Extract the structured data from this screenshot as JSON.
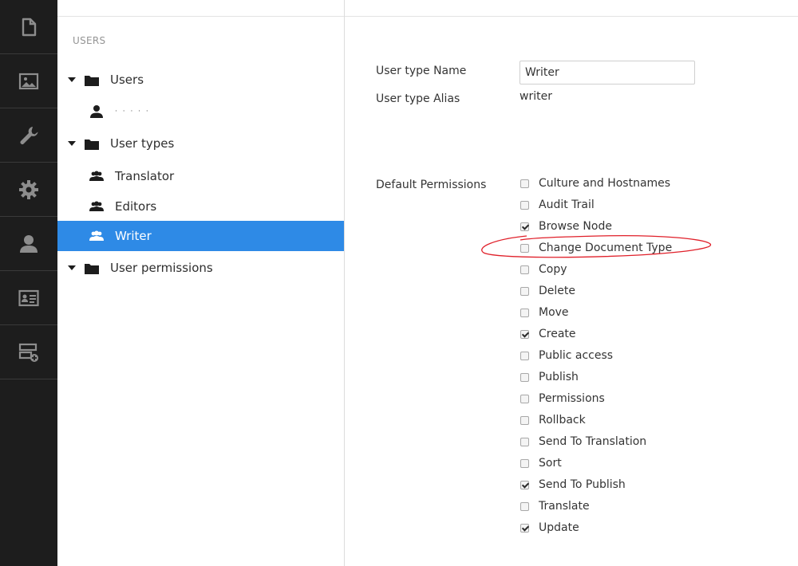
{
  "rail": {
    "items": [
      {
        "icon": "document-icon",
        "name": "rail-content"
      },
      {
        "icon": "image-icon",
        "name": "rail-media"
      },
      {
        "icon": "wrench-icon",
        "name": "rail-settings"
      },
      {
        "icon": "gear-icon",
        "name": "rail-developer"
      },
      {
        "icon": "user-icon",
        "name": "rail-users"
      },
      {
        "icon": "id-card-icon",
        "name": "rail-members"
      },
      {
        "icon": "forms-icon",
        "name": "rail-forms"
      }
    ]
  },
  "tree": {
    "heading": "USERS",
    "items": [
      {
        "label": "Users"
      },
      {
        "label": "· ·  ·   ·    ·"
      },
      {
        "label": "User types"
      },
      {
        "label": "Translator"
      },
      {
        "label": "Editors"
      },
      {
        "label": "Writer"
      },
      {
        "label": "User permissions"
      }
    ]
  },
  "editor": {
    "name_label": "User type Name",
    "name_value": "Writer",
    "alias_label": "User type Alias",
    "alias_value": "writer",
    "permissions_label": "Default Permissions",
    "permissions": [
      {
        "label": "Culture and Hostnames",
        "checked": false
      },
      {
        "label": "Audit Trail",
        "checked": false
      },
      {
        "label": "Browse Node",
        "checked": true
      },
      {
        "label": "Change Document Type",
        "checked": false
      },
      {
        "label": "Copy",
        "checked": false
      },
      {
        "label": "Delete",
        "checked": false
      },
      {
        "label": "Move",
        "checked": false
      },
      {
        "label": "Create",
        "checked": true
      },
      {
        "label": "Public access",
        "checked": false
      },
      {
        "label": "Publish",
        "checked": false
      },
      {
        "label": "Permissions",
        "checked": false
      },
      {
        "label": "Rollback",
        "checked": false
      },
      {
        "label": "Send To Translation",
        "checked": false
      },
      {
        "label": "Sort",
        "checked": false
      },
      {
        "label": "Send To Publish",
        "checked": true
      },
      {
        "label": "Translate",
        "checked": false
      },
      {
        "label": "Update",
        "checked": true
      }
    ]
  },
  "colors": {
    "rail_bg": "#1d1d1d",
    "rail_icon": "#8d8d8d",
    "selection": "#2e8ae6",
    "annotation": "#e0202a"
  }
}
